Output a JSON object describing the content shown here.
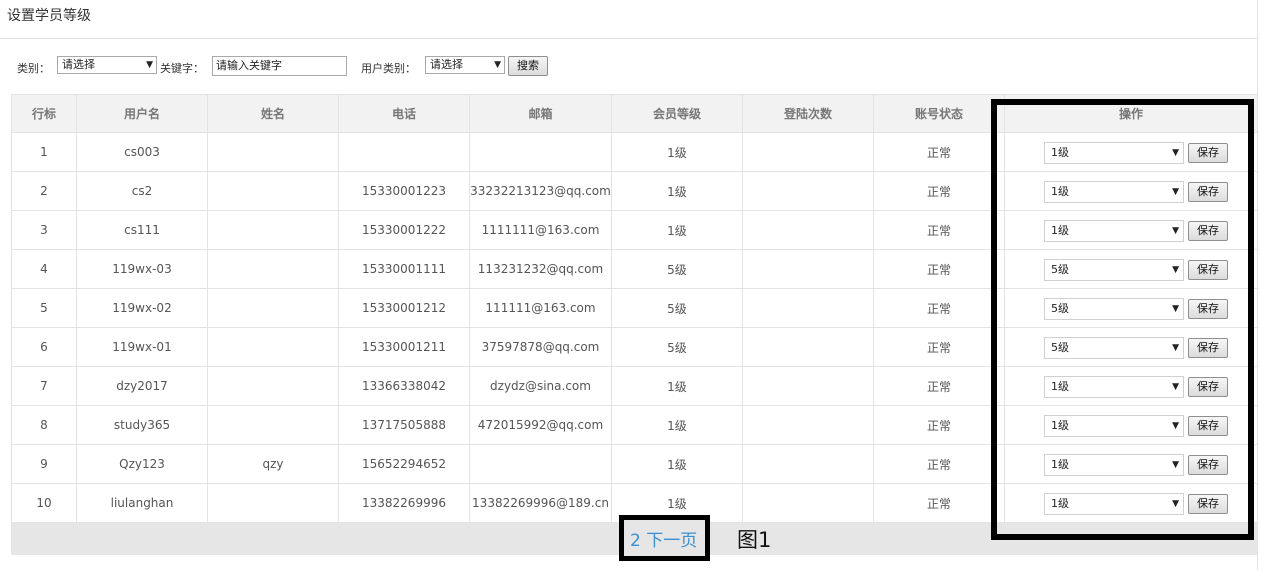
{
  "page_title": "设置学员等级",
  "filters": {
    "category_label": "类别：",
    "category_value": "请选择",
    "keyword_label": "关键字：",
    "keyword_placeholder": "请输入关键字",
    "user_type_label": "用户类别：",
    "user_type_value": "请选择",
    "search_button": "搜索"
  },
  "table": {
    "headers": [
      "行标",
      "用户名",
      "姓名",
      "电话",
      "邮箱",
      "会员等级",
      "登陆次数",
      "账号状态",
      "操作"
    ],
    "rows": [
      {
        "index": "1",
        "username": "cs003",
        "name": "",
        "phone": "",
        "email": "",
        "level": "1级",
        "logins": "",
        "status": "正常",
        "select": "1级"
      },
      {
        "index": "2",
        "username": "cs2",
        "name": "",
        "phone": "15330001223",
        "email": "33232213123@qq.com",
        "level": "1级",
        "logins": "",
        "status": "正常",
        "select": "1级"
      },
      {
        "index": "3",
        "username": "cs111",
        "name": "",
        "phone": "15330001222",
        "email": "1111111@163.com",
        "level": "1级",
        "logins": "",
        "status": "正常",
        "select": "1级"
      },
      {
        "index": "4",
        "username": "119wx-03",
        "name": "",
        "phone": "15330001111",
        "email": "113231232@qq.com",
        "level": "5级",
        "logins": "",
        "status": "正常",
        "select": "5级"
      },
      {
        "index": "5",
        "username": "119wx-02",
        "name": "",
        "phone": "15330001212",
        "email": "111111@163.com",
        "level": "5级",
        "logins": "",
        "status": "正常",
        "select": "5级"
      },
      {
        "index": "6",
        "username": "119wx-01",
        "name": "",
        "phone": "15330001211",
        "email": "37597878@qq.com",
        "level": "5级",
        "logins": "",
        "status": "正常",
        "select": "5级"
      },
      {
        "index": "7",
        "username": "dzy2017",
        "name": "",
        "phone": "13366338042",
        "email": "dzydz@sina.com",
        "level": "1级",
        "logins": "",
        "status": "正常",
        "select": "1级"
      },
      {
        "index": "8",
        "username": "study365",
        "name": "",
        "phone": "13717505888",
        "email": "472015992@qq.com",
        "level": "1级",
        "logins": "",
        "status": "正常",
        "select": "1级"
      },
      {
        "index": "9",
        "username": "Qzy123",
        "name": "qzy",
        "phone": "15652294652",
        "email": "",
        "level": "1级",
        "logins": "",
        "status": "正常",
        "select": "1级"
      },
      {
        "index": "10",
        "username": "liulanghan",
        "name": "",
        "phone": "13382269996",
        "email": "13382269996@189.cn",
        "level": "1级",
        "logins": "",
        "status": "正常",
        "select": "1级"
      }
    ],
    "save_label": "保存"
  },
  "pagination": {
    "link": "2 下一页"
  },
  "figure_label": "图1",
  "colors": {
    "link": "#3a8fd3",
    "header_bg": "#f2f2f2",
    "footer_bg": "#e6e6e6",
    "annotation": "#000000"
  },
  "icons": {
    "dropdown": "triangle-down-icon"
  }
}
